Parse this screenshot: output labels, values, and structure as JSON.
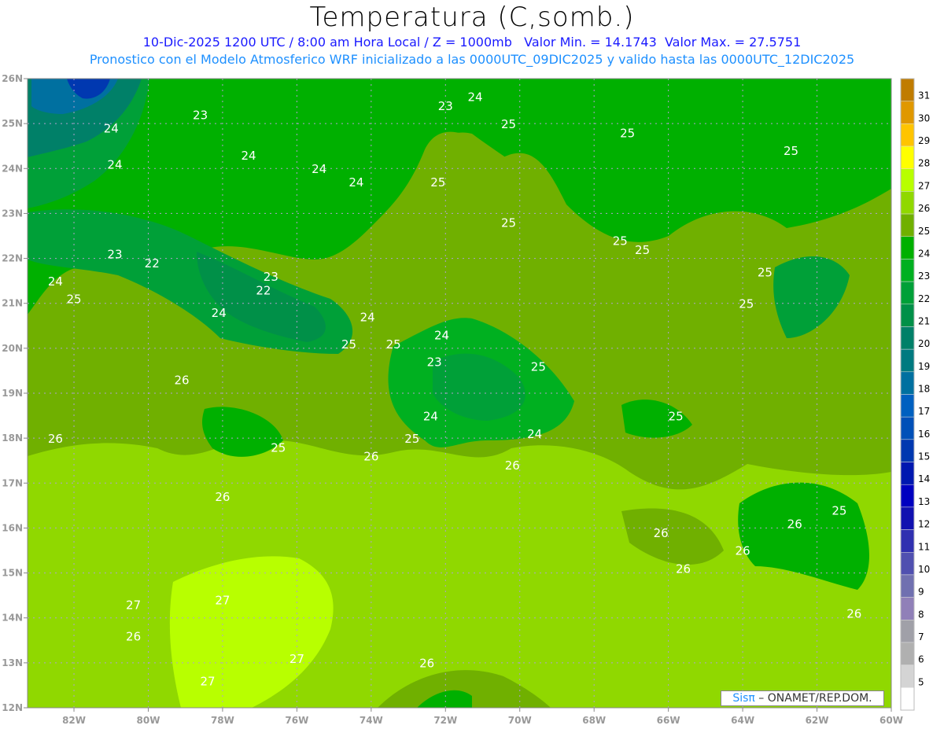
{
  "title": "Temperatura (C,somb.)",
  "subtitle_date": "10-Dic-2025  1200 UTC / 8:00 am Hora Local / Z = 1000mb",
  "subtitle_min": "Valor Min. = 14.1743",
  "subtitle_max": "Valor Max. = 27.5751",
  "subtitle_model": "Pronostico con el Modelo Atmosferico WRF inicializado a las 0000UTC_09DIC2025 y valido hasta las  0000UTC_12DIC2025",
  "logo": {
    "brand": "Sisπ",
    "text": " – ONAMET/REP.DOM."
  },
  "chart_data": {
    "type": "heatmap",
    "variable": "Temperature at 1000mb (C)",
    "xlim": [
      -83.25,
      -60
    ],
    "ylim": [
      12,
      26
    ],
    "x_ticks": [
      "82W",
      "80W",
      "78W",
      "76W",
      "74W",
      "72W",
      "70W",
      "68W",
      "66W",
      "64W",
      "62W",
      "60W"
    ],
    "y_ticks": [
      "26N",
      "25N",
      "24N",
      "23N",
      "22N",
      "21N",
      "20N",
      "19N",
      "18N",
      "17N",
      "16N",
      "15N",
      "14N",
      "13N",
      "12N"
    ],
    "grid": true,
    "colorbar": {
      "placement": "right",
      "labels": [
        31,
        30,
        29,
        28,
        27,
        26,
        25,
        24,
        23,
        22,
        21,
        20,
        19,
        18,
        17,
        16,
        15,
        14,
        13,
        12,
        11,
        10,
        9,
        8,
        7,
        6,
        5
      ],
      "colors": [
        "#c07c00",
        "#e09800",
        "#ffc400",
        "#ffff00",
        "#b8ff00",
        "#90d800",
        "#70b000",
        "#00b000",
        "#00b020",
        "#00a038",
        "#009048",
        "#008068",
        "#007a80",
        "#0070a0",
        "#0060c0",
        "#0050b8",
        "#0038b0",
        "#0018b0",
        "#0000c0",
        "#1010b0",
        "#3030b0",
        "#5050b0",
        "#7070b0",
        "#9080b8",
        "#a0a0a8",
        "#b0b0b0",
        "#d4d4d4",
        "#ffffff"
      ]
    },
    "contour_labels": [
      {
        "text": "24",
        "lon": -81,
        "lat": 24.8
      },
      {
        "text": "23",
        "lon": -78.6,
        "lat": 25.1
      },
      {
        "text": "24",
        "lon": -77.3,
        "lat": 24.2
      },
      {
        "text": "24",
        "lon": -75.4,
        "lat": 23.9
      },
      {
        "text": "24",
        "lon": -80.9,
        "lat": 24.0
      },
      {
        "text": "24",
        "lon": -74.4,
        "lat": 23.6
      },
      {
        "text": "23",
        "lon": -72,
        "lat": 25.3
      },
      {
        "text": "24",
        "lon": -71.2,
        "lat": 25.5
      },
      {
        "text": "25",
        "lon": -70.3,
        "lat": 24.9
      },
      {
        "text": "25",
        "lon": -72.2,
        "lat": 23.6
      },
      {
        "text": "25",
        "lon": -70.3,
        "lat": 22.7
      },
      {
        "text": "25",
        "lon": -67.1,
        "lat": 24.7
      },
      {
        "text": "25",
        "lon": -62.7,
        "lat": 24.3
      },
      {
        "text": "25",
        "lon": -67.3,
        "lat": 22.3
      },
      {
        "text": "25",
        "lon": -66.7,
        "lat": 22.1
      },
      {
        "text": "25",
        "lon": -63.4,
        "lat": 21.6
      },
      {
        "text": "25",
        "lon": -63.9,
        "lat": 20.9
      },
      {
        "text": "24",
        "lon": -82.5,
        "lat": 21.4
      },
      {
        "text": "25",
        "lon": -82,
        "lat": 21.0
      },
      {
        "text": "23",
        "lon": -80.9,
        "lat": 22.0
      },
      {
        "text": "22",
        "lon": -79.9,
        "lat": 21.8
      },
      {
        "text": "23",
        "lon": -76.7,
        "lat": 21.5
      },
      {
        "text": "22",
        "lon": -76.9,
        "lat": 21.2
      },
      {
        "text": "24",
        "lon": -78.1,
        "lat": 20.7
      },
      {
        "text": "24",
        "lon": -74.1,
        "lat": 20.6
      },
      {
        "text": "25",
        "lon": -74.6,
        "lat": 20.0
      },
      {
        "text": "25",
        "lon": -73.4,
        "lat": 20.0
      },
      {
        "text": "24",
        "lon": -72.1,
        "lat": 20.2
      },
      {
        "text": "23",
        "lon": -72.3,
        "lat": 19.6
      },
      {
        "text": "25",
        "lon": -69.5,
        "lat": 19.5
      },
      {
        "text": "24",
        "lon": -72.4,
        "lat": 18.4
      },
      {
        "text": "25",
        "lon": -72.9,
        "lat": 17.9
      },
      {
        "text": "24",
        "lon": -69.6,
        "lat": 18.0
      },
      {
        "text": "25",
        "lon": -65.8,
        "lat": 18.4
      },
      {
        "text": "25",
        "lon": -76.5,
        "lat": 17.7
      },
      {
        "text": "26",
        "lon": -79.1,
        "lat": 19.2
      },
      {
        "text": "26",
        "lon": -82.5,
        "lat": 17.9
      },
      {
        "text": "26",
        "lon": -74,
        "lat": 17.5
      },
      {
        "text": "26",
        "lon": -70.2,
        "lat": 17.3
      },
      {
        "text": "26",
        "lon": -78,
        "lat": 16.6
      },
      {
        "text": "26",
        "lon": -66.2,
        "lat": 15.8
      },
      {
        "text": "26",
        "lon": -65.6,
        "lat": 15.0
      },
      {
        "text": "26",
        "lon": -64,
        "lat": 15.4
      },
      {
        "text": "25",
        "lon": -61.4,
        "lat": 16.3
      },
      {
        "text": "26",
        "lon": -62.6,
        "lat": 16.0
      },
      {
        "text": "27",
        "lon": -80.4,
        "lat": 14.2
      },
      {
        "text": "26",
        "lon": -80.4,
        "lat": 13.5
      },
      {
        "text": "27",
        "lon": -78,
        "lat": 14.3
      },
      {
        "text": "27",
        "lon": -76,
        "lat": 13.0
      },
      {
        "text": "27",
        "lon": -78.4,
        "lat": 12.5
      },
      {
        "text": "26",
        "lon": -72.5,
        "lat": 12.9
      },
      {
        "text": "26",
        "lon": -61,
        "lat": 14.0
      }
    ]
  }
}
